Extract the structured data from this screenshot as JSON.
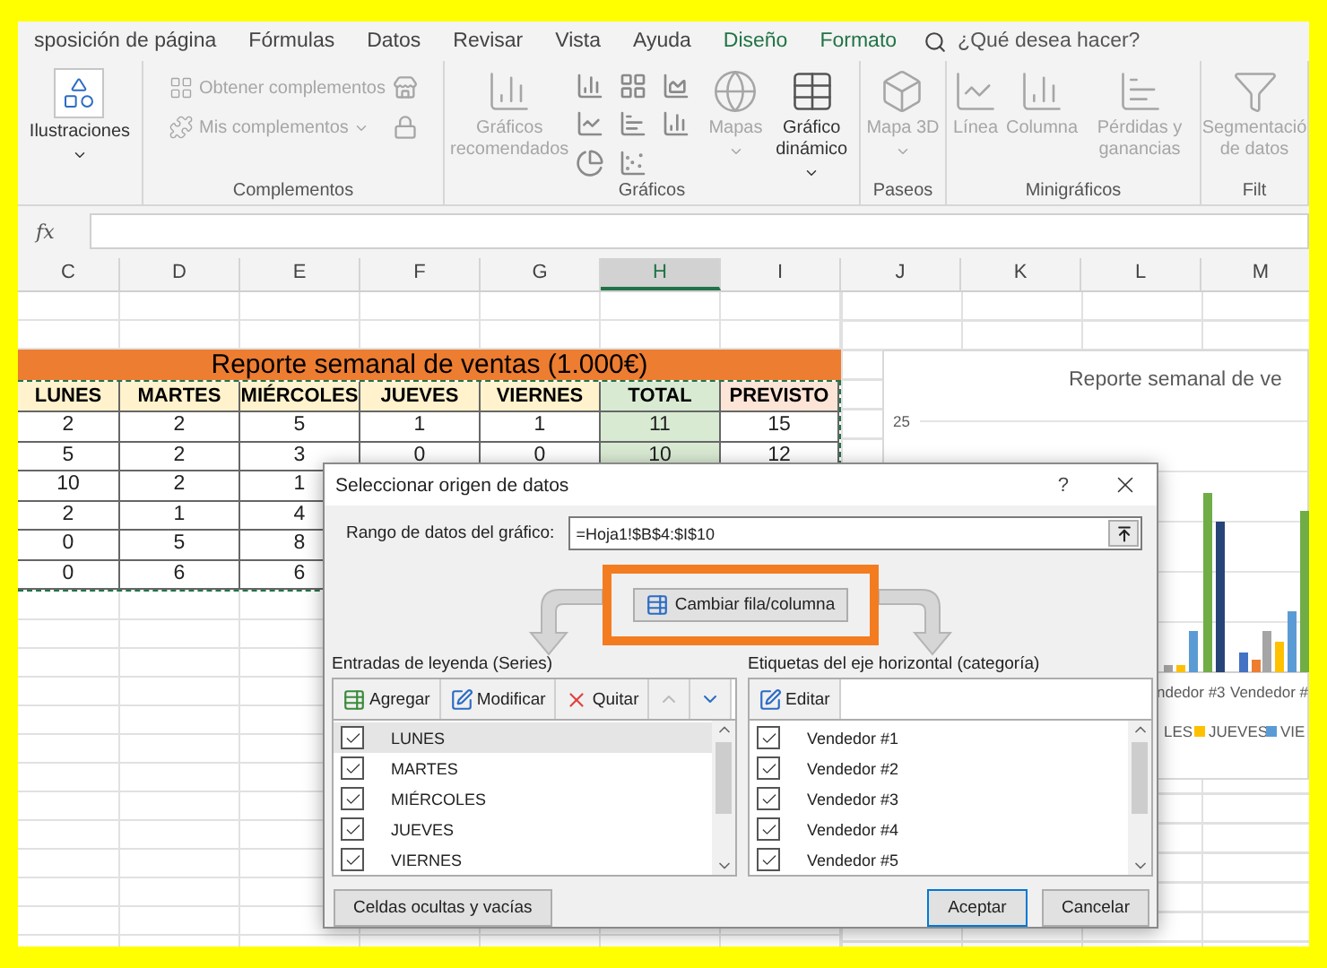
{
  "ribbon": {
    "tabs": [
      {
        "label": "sposición de página",
        "contextual": false
      },
      {
        "label": "Fórmulas",
        "contextual": false
      },
      {
        "label": "Datos",
        "contextual": false
      },
      {
        "label": "Revisar",
        "contextual": false
      },
      {
        "label": "Vista",
        "contextual": false
      },
      {
        "label": "Ayuda",
        "contextual": false
      },
      {
        "label": "Diseño",
        "contextual": true
      },
      {
        "label": "Formato",
        "contextual": true
      }
    ],
    "tell_me": "¿Qué desea hacer?",
    "groups": [
      {
        "kind": "illustrations",
        "commands": [
          {
            "kind": "large",
            "label": "Ilustraciones",
            "dropdown": true,
            "disabled": false
          }
        ]
      },
      {
        "kind": "addins",
        "label": "Complementos",
        "commands": [
          {
            "kind": "small",
            "label": "Obtener complementos",
            "dropdown": false,
            "disabled": true
          },
          {
            "kind": "small",
            "label": "Mis complementos",
            "dropdown": true,
            "disabled": true
          }
        ]
      },
      {
        "kind": "charts",
        "label": "Gráficos",
        "commands": [
          {
            "kind": "large",
            "label": "Gráficos recomendados",
            "dropdown": false,
            "disabled": true
          },
          {
            "kind": "grid"
          },
          {
            "kind": "large",
            "label": "Mapas",
            "dropdown": true,
            "disabled": true
          },
          {
            "kind": "large",
            "label": "Gráfico dinámico",
            "dropdown": true,
            "disabled": false
          }
        ]
      },
      {
        "kind": "tours",
        "label": "Paseos",
        "commands": [
          {
            "kind": "large",
            "label": "Mapa 3D",
            "dropdown": true,
            "disabled": true
          }
        ]
      },
      {
        "kind": "sparklines",
        "label": "Minigráficos",
        "commands": [
          {
            "kind": "large",
            "label": "Línea",
            "dropdown": false,
            "disabled": true
          },
          {
            "kind": "large",
            "label": "Columna",
            "dropdown": false,
            "disabled": true
          },
          {
            "kind": "large",
            "label": "Pérdidas y ganancias",
            "dropdown": false,
            "disabled": true
          }
        ]
      },
      {
        "kind": "filters",
        "label": "Filt",
        "commands": [
          {
            "kind": "large",
            "label": "Segmentació de datos",
            "dropdown": false,
            "disabled": true
          }
        ]
      }
    ]
  },
  "formula_bar": {
    "label": "fx"
  },
  "sheet": {
    "columns": [
      {
        "label": "C",
        "selected": false
      },
      {
        "label": "D",
        "selected": false
      },
      {
        "label": "E",
        "selected": false
      },
      {
        "label": "F",
        "selected": false
      },
      {
        "label": "G",
        "selected": false
      },
      {
        "label": "H",
        "selected": true
      },
      {
        "label": "I",
        "selected": false
      },
      {
        "label": "J",
        "selected": false
      },
      {
        "label": "K",
        "selected": false
      },
      {
        "label": "L",
        "selected": false
      },
      {
        "label": "M",
        "selected": false
      }
    ],
    "title": "Reporte semanal de ventas (1.000€)",
    "headers": [
      {
        "label": "LUNES",
        "kind": "day"
      },
      {
        "label": "MARTES",
        "kind": "day"
      },
      {
        "label": "MIÉRCOLES",
        "kind": "day"
      },
      {
        "label": "JUEVES",
        "kind": "day"
      },
      {
        "label": "VIERNES",
        "kind": "day"
      },
      {
        "label": "TOTAL",
        "kind": "total"
      },
      {
        "label": "PREVISTO",
        "kind": "target"
      }
    ],
    "rows": [
      [
        "2",
        "2",
        "5",
        "1",
        "1",
        "11",
        "15"
      ],
      [
        "5",
        "2",
        "3",
        "0",
        "0",
        "10",
        "12"
      ],
      [
        "10",
        "2",
        "1"
      ],
      [
        "2",
        "1",
        "4"
      ],
      [
        "0",
        "5",
        "8"
      ],
      [
        "0",
        "6",
        "6"
      ]
    ]
  },
  "chart": {
    "title": "Reporte semanal de ve",
    "y_tick": "25",
    "categories": [
      "ndedor #3",
      "Vendedor #"
    ],
    "legend": [
      {
        "label": "LES"
      },
      {
        "label": "JUEVES",
        "color": "#ffc000"
      },
      {
        "label": "VIE",
        "color": "#5b9bd5"
      }
    ]
  },
  "dialog": {
    "title": "Seleccionar origen de datos",
    "help": "?",
    "range_label": "Rango de datos del gráfico:",
    "range_value": "=Hoja1!$B$4:$I$10",
    "switch_button": "Cambiar fila/columna",
    "legend": {
      "title": "Entradas de leyenda (Series)",
      "buttons": [
        {
          "kind": "add",
          "label": "Agregar",
          "disabled": false
        },
        {
          "kind": "edit",
          "label": "Modificar",
          "disabled": false
        },
        {
          "kind": "remove",
          "label": "Quitar",
          "disabled": false
        },
        {
          "kind": "up",
          "disabled": true
        },
        {
          "kind": "down",
          "disabled": false
        }
      ],
      "items": [
        {
          "label": "LUNES",
          "checked": true,
          "selected": true
        },
        {
          "label": "MARTES",
          "checked": true,
          "selected": false
        },
        {
          "label": "MIÉRCOLES",
          "checked": true,
          "selected": false
        },
        {
          "label": "JUEVES",
          "checked": true,
          "selected": false
        },
        {
          "label": "VIERNES",
          "checked": true,
          "selected": false
        }
      ]
    },
    "axis": {
      "title": "Etiquetas del eje horizontal (categoría)",
      "buttons": [
        {
          "kind": "edit",
          "label": "Editar",
          "disabled": false
        }
      ],
      "items": [
        {
          "label": "Vendedor #1",
          "checked": true,
          "selected": false
        },
        {
          "label": "Vendedor #2",
          "checked": true,
          "selected": false
        },
        {
          "label": "Vendedor #3",
          "checked": true,
          "selected": false
        },
        {
          "label": "Vendedor #4",
          "checked": true,
          "selected": false
        },
        {
          "label": "Vendedor #5",
          "checked": true,
          "selected": false
        }
      ]
    },
    "hidden_cells_button": "Celdas ocultas y vacías",
    "ok_button": "Aceptar",
    "cancel_button": "Cancelar"
  }
}
